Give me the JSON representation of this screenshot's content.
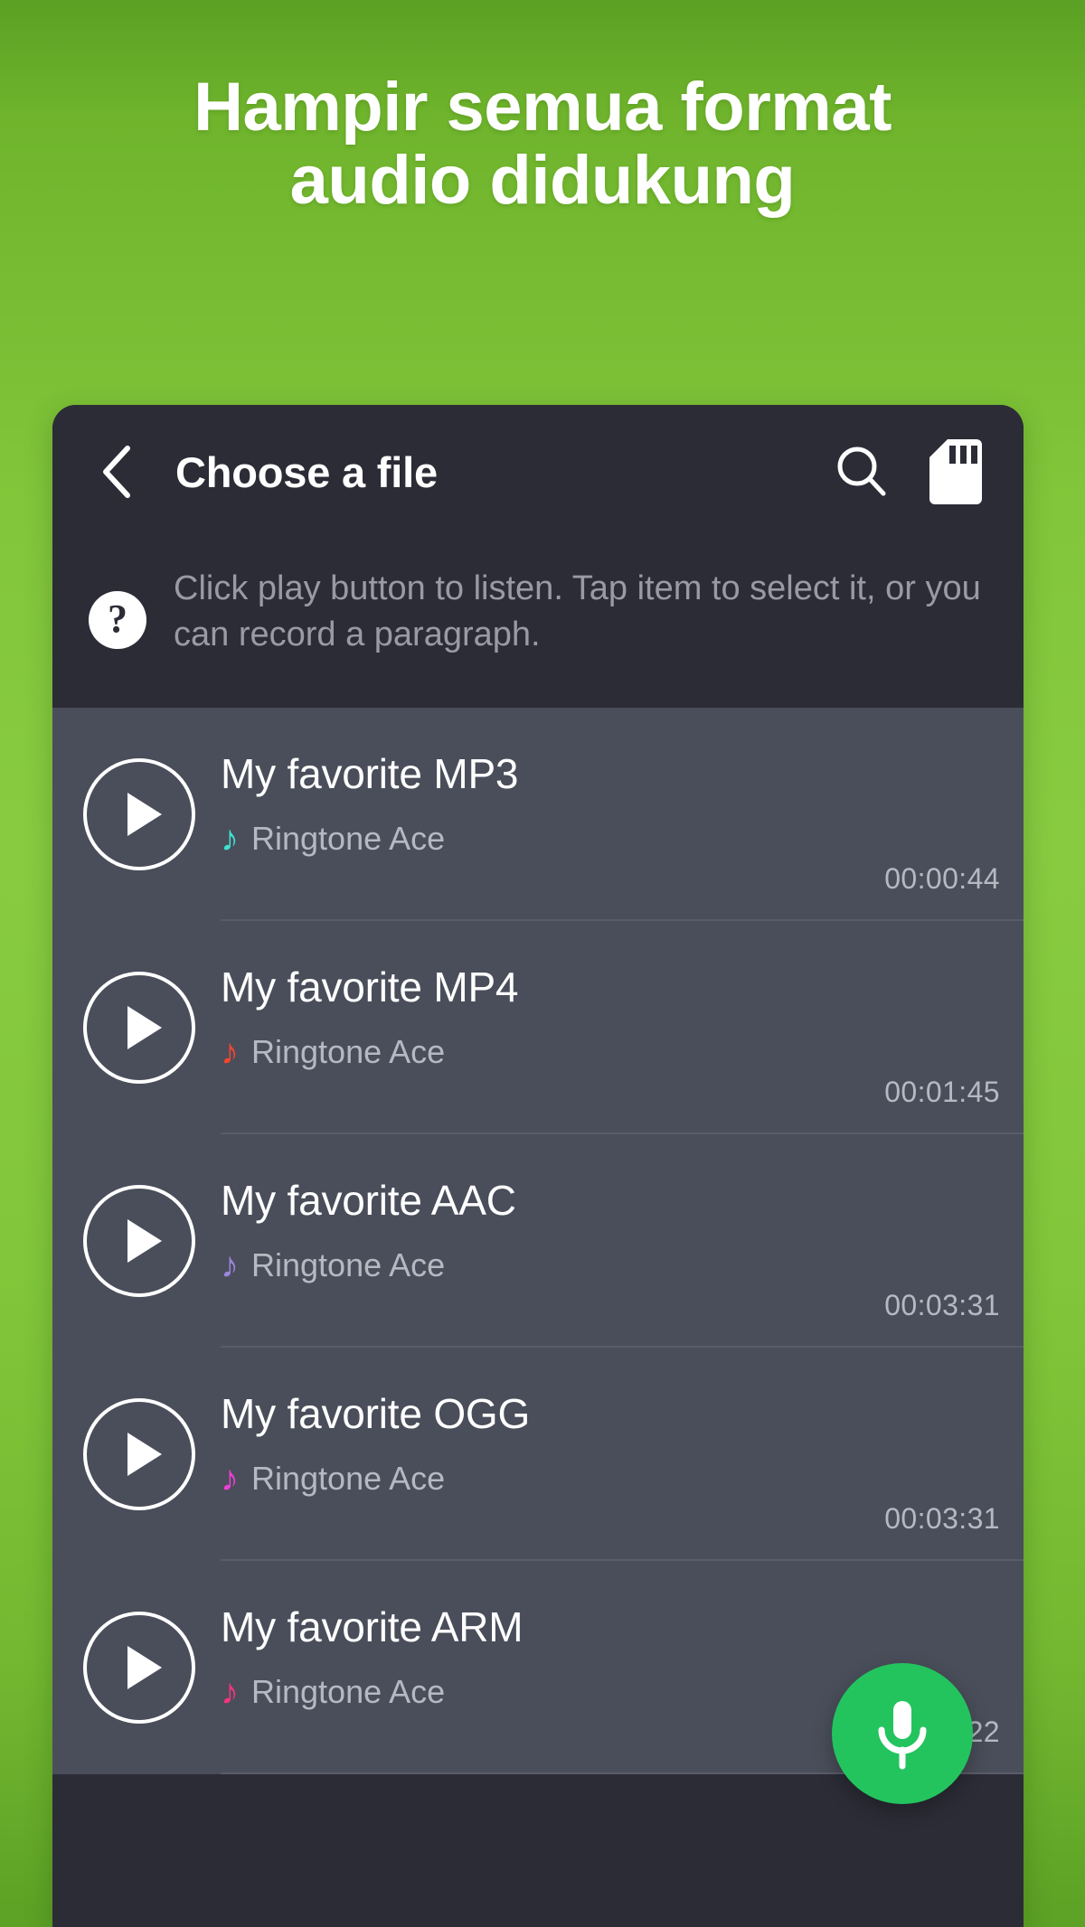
{
  "promo": {
    "headline_line1": "Hampir semua format",
    "headline_line2": "audio didukung",
    "background_top_color": "#5ca024",
    "background_mid_color": "#88cb41",
    "background_bottom_color": "#5da125"
  },
  "app": {
    "appbar": {
      "back_label": "Back",
      "title": "Choose a file",
      "search_icon": "search-icon",
      "sd_card_icon": "sd-card-icon",
      "background_color": "#2c2c37"
    },
    "help": {
      "badge_glyph": "?",
      "text": "Click play button to listen. Tap item to select it, or you can record a paragraph.",
      "text_color": "#9a9aa6"
    },
    "list": {
      "background_color": "#4a4e5a",
      "items": [
        {
          "title": "My favorite MP3",
          "artist": "Ringtone Ace",
          "duration": "00:00:44",
          "note_icon": "music-note-icon",
          "note_color": "#3fe0d0",
          "play_icon": "play-icon"
        },
        {
          "title": "My favorite MP4",
          "artist": "Ringtone Ace",
          "duration": "00:01:45",
          "note_icon": "music-note-icon",
          "note_color": "#f4452f",
          "play_icon": "play-icon"
        },
        {
          "title": "My favorite AAC",
          "artist": "Ringtone Ace",
          "duration": "00:03:31",
          "note_icon": "music-note-icon",
          "note_color": "#9a86dd",
          "play_icon": "play-icon"
        },
        {
          "title": "My favorite OGG",
          "artist": "Ringtone Ace",
          "duration": "00:03:31",
          "note_icon": "music-note-icon",
          "note_color": "#ef3fd6",
          "play_icon": "play-icon"
        },
        {
          "title": "My favorite ARM",
          "artist": "Ringtone Ace",
          "duration": "5:22",
          "note_icon": "music-note-icon",
          "note_color": "#f6337e",
          "play_icon": "play-icon"
        }
      ]
    },
    "fab": {
      "icon": "microphone-icon",
      "color": "#23c45e",
      "label": "Record"
    }
  }
}
